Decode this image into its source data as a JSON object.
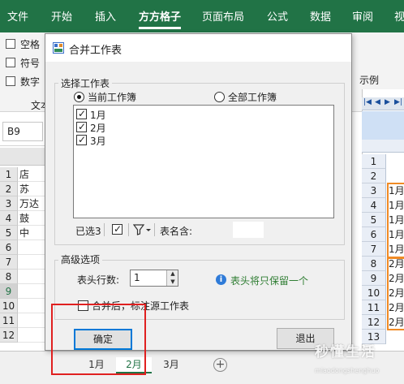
{
  "ribbon": {
    "tabs": [
      "文件",
      "开始",
      "插入",
      "方方格子",
      "页面布局",
      "公式",
      "数据",
      "审阅",
      "视"
    ],
    "active_tab": "方方格子",
    "accent_color": "#217346",
    "checkboxes": [
      "空格",
      "符号",
      "数字"
    ],
    "group_label": "文本"
  },
  "namebox": {
    "value": "B9"
  },
  "sheet": {
    "rows": [
      "1",
      "2",
      "3",
      "4",
      "5",
      "6",
      "7",
      "8",
      "9",
      "10",
      "11",
      "12"
    ],
    "cells": [
      "店",
      "苏",
      "万达",
      "鼓",
      "中",
      "",
      "",
      "",
      "",
      "",
      "",
      ""
    ],
    "selected_row": "9",
    "tabs": [
      "1月",
      "2月",
      "3月"
    ],
    "active_tab": "2月",
    "add_icon": "plus-icon"
  },
  "dialog": {
    "title": "合并工作表",
    "icon": "merge-icon",
    "select_group": "选择工作表",
    "radio_current": "当前工作簿",
    "radio_all": "全部工作簿",
    "selected_radio": "当前工作簿",
    "sheets": [
      {
        "label": "1月",
        "checked": true
      },
      {
        "label": "2月",
        "checked": true
      },
      {
        "label": "3月",
        "checked": true
      }
    ],
    "selected_count": "已选3",
    "name_contains": "表名含:",
    "advanced_group": "高级选项",
    "header_rows_label": "表头行数:",
    "header_rows_value": "1",
    "info_text": "表头将只保留一个",
    "mark_source_label": "合并后，标注源工作表",
    "mark_source_checked": false,
    "ok_label": "确定",
    "cancel_label": "退出"
  },
  "example": {
    "label": "示例",
    "rows": [
      "1",
      "2",
      "3",
      "4",
      "5",
      "6",
      "7",
      "8",
      "9",
      "10",
      "11",
      "12",
      "13"
    ],
    "cells": [
      "",
      "",
      "1月",
      "1月",
      "1月",
      "1月",
      "1月",
      "2月",
      "2月",
      "2月",
      "2月",
      "2月",
      ""
    ]
  },
  "watermark": {
    "main": "秒懂生活",
    "sub": "miaodongshenghuo"
  }
}
